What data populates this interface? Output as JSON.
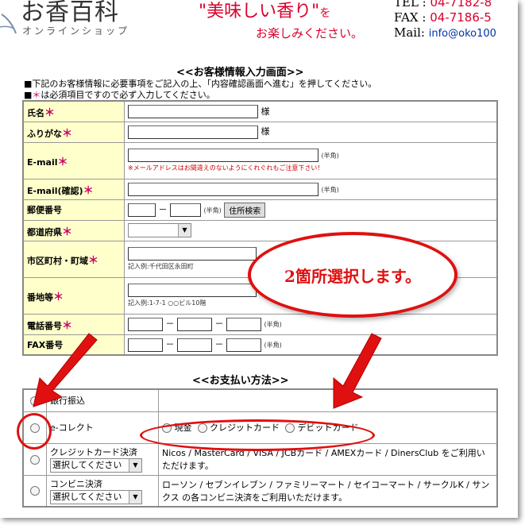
{
  "header": {
    "logo_title": "お香百科",
    "logo_subtitle": "オンラインショップ",
    "tagline_main": "\"美味しい香り\"",
    "tagline_particle": "を",
    "tagline_sub": "お楽しみください。",
    "tel_label": "TEL :",
    "tel_value": "04-7182-8",
    "fax_label": "FAX :",
    "fax_value": "04-7186-5",
    "mail_label": "Mail:",
    "mail_value": "info@oko100"
  },
  "customer_section": {
    "title": "<<お客様情報入力画面>>",
    "note1": "■下記のお客様情報に必要事項をご記入の上、「内容確認画面へ進む」を押してください。",
    "note2_prefix": "■",
    "note2_star": "＊",
    "note2_text": "は必須項目ですので必ず入力してください。",
    "required_mark": "＊",
    "fields": {
      "name": {
        "label": "氏名",
        "suffix": "様"
      },
      "furigana": {
        "label": "ふりがな",
        "suffix": "様"
      },
      "email": {
        "label": "E-mail",
        "hint": "(半角)",
        "warning": "※メールアドレスはお間違えのないようにくれぐれもご注意下さい！"
      },
      "email_confirm": {
        "label": "E-mail(確認)",
        "hint": "(半角)"
      },
      "postal": {
        "label": "郵便番号",
        "dash": "－",
        "hint": "(半角)",
        "button": "住所検索"
      },
      "prefecture": {
        "label": "都道府県"
      },
      "city": {
        "label": "市区町村・町域",
        "example": "記入例:千代田区永田町"
      },
      "address": {
        "label": "番地等",
        "example": "記入例:1-7-1 ○○ビル10階"
      },
      "phone": {
        "label": "電話番号",
        "dash": "－",
        "hint": "(半角)"
      },
      "fax": {
        "label": "FAX番号",
        "dash": "－",
        "hint": "(半角)"
      }
    }
  },
  "payment_section": {
    "title": "<<お支払い方法>>",
    "options": {
      "bank": {
        "label": "銀行振込"
      },
      "ecollect": {
        "label": "e-コレクト",
        "sub_options": [
          "現金",
          "クレジットカード",
          "デビットカード"
        ]
      },
      "credit": {
        "label": "クレジットカード決済",
        "select": "選択してください",
        "desc": "Nicos / MasterCard / VISA / JCBカード / AMEXカード / DinersClub をご利用いただけます。"
      },
      "convenience": {
        "label": "コンビニ決済",
        "select": "選択してください",
        "desc": "ローソン / セブンイレブン / ファミリーマート / セイコーマート / サークルK / サンクス の各コンビニ決済をご利用いただけます。"
      }
    }
  },
  "annotation": {
    "callout_text": "2箇所選択します。",
    "color": "#e01010"
  }
}
